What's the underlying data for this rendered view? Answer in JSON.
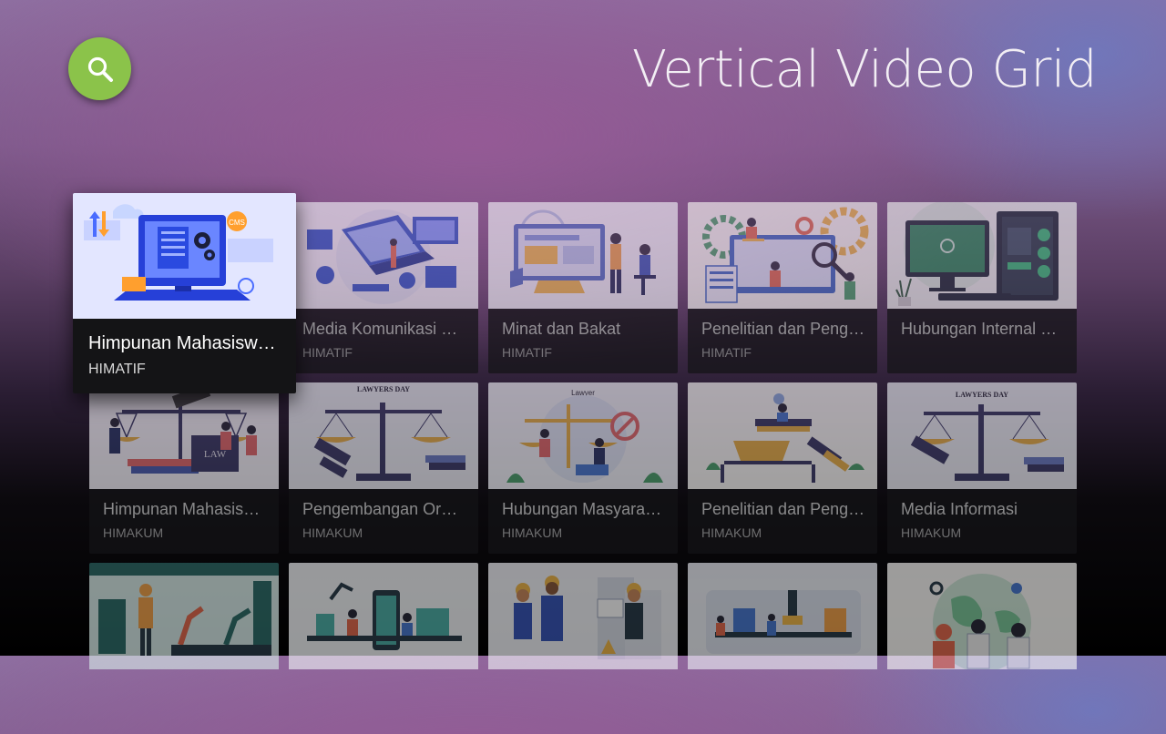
{
  "header": {
    "title": "Vertical Video Grid",
    "search_icon": "search-icon",
    "search_color": "#8bc34a"
  },
  "grid": {
    "cards": [
      {
        "title": "Himpunan Mahasiswa ...",
        "subtitle": "HIMATIF",
        "thumb_icon": "cms-computer-illustration",
        "focused": true
      },
      {
        "title": "Media Komunikasi dan...",
        "subtitle": "HIMATIF",
        "thumb_icon": "laptop-network-illustration"
      },
      {
        "title": "Minat dan Bakat",
        "subtitle": "HIMATIF",
        "thumb_icon": "dashboard-people-illustration"
      },
      {
        "title": "Penelitian dan Penge...",
        "subtitle": "HIMATIF",
        "thumb_icon": "research-gears-illustration"
      },
      {
        "title": "Hubungan Internal dan...",
        "subtitle": "",
        "thumb_icon": "desktop-pc-illustration"
      },
      {
        "title": "Himpunan Mahasiswa ...",
        "subtitle": "HIMAKUM",
        "thumb_icon": "law-scale-illustration"
      },
      {
        "title": "Pengembangan Organi...",
        "subtitle": "HIMAKUM",
        "thumb_icon": "lawyers-day-gavel-illustration",
        "banner": "LAWYERS DAY"
      },
      {
        "title": "Hubungan Masyarakat",
        "subtitle": "HIMAKUM",
        "thumb_icon": "lawyer-scale-illustration",
        "banner": "Lawyer"
      },
      {
        "title": "Penelitian dan Penge...",
        "subtitle": "HIMAKUM",
        "thumb_icon": "books-gavel-illustration"
      },
      {
        "title": "Media Informasi",
        "subtitle": "HIMAKUM",
        "thumb_icon": "lawyers-day-scale-illustration",
        "banner": "LAWYERS DAY"
      },
      {
        "title": "",
        "subtitle": "",
        "thumb_icon": "factory-robots-illustration"
      },
      {
        "title": "",
        "subtitle": "",
        "thumb_icon": "mobile-factory-illustration"
      },
      {
        "title": "",
        "subtitle": "",
        "thumb_icon": "engineers-illustration"
      },
      {
        "title": "",
        "subtitle": "",
        "thumb_icon": "assembly-line-illustration"
      },
      {
        "title": "",
        "subtitle": "",
        "thumb_icon": "globe-team-illustration"
      }
    ]
  }
}
